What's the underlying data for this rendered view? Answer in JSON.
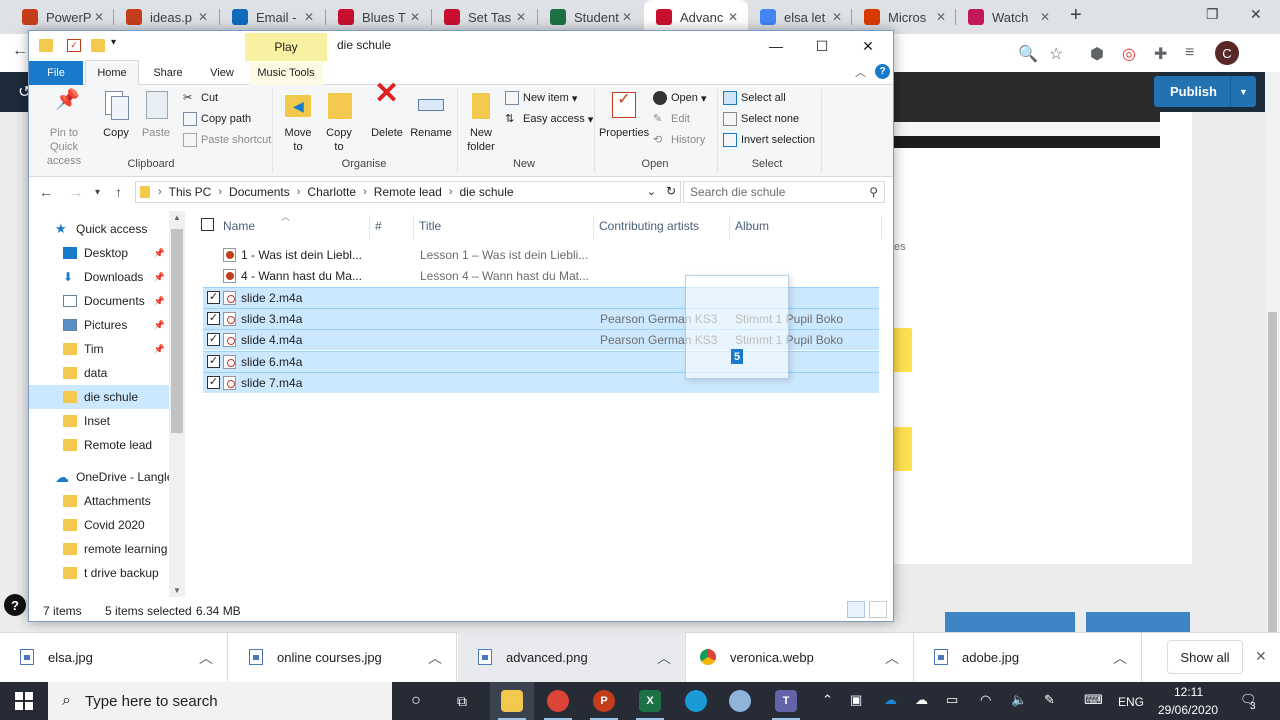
{
  "browser": {
    "tabs": [
      {
        "label": "PowerP",
        "icon": "powerpoint-icon",
        "color": "#c43e1c"
      },
      {
        "label": "ideas.p",
        "icon": "powerpoint-icon",
        "color": "#c43e1c"
      },
      {
        "label": "Email -",
        "icon": "outlook-icon",
        "color": "#0f6cbd"
      },
      {
        "label": "Blues T",
        "icon": "adobe-spark-icon",
        "color": "#c8102e"
      },
      {
        "label": "Set Tas",
        "icon": "adobe-spark-icon",
        "color": "#c8102e"
      },
      {
        "label": "Student",
        "icon": "excel-icon",
        "color": "#1e7145"
      },
      {
        "label": "Advanc",
        "icon": "adobe-spark-icon",
        "color": "#c8102e"
      },
      {
        "label": "elsa let",
        "icon": "google-icon",
        "color": "#4285f4"
      },
      {
        "label": "Micros",
        "icon": "office-icon",
        "color": "#d83b01"
      },
      {
        "label": "Watch",
        "icon": "play-icon",
        "color": "#c2185b"
      }
    ],
    "new_tab": "+",
    "profile_initial": "C",
    "publish_label": "Publish",
    "page_text": "es"
  },
  "explorer": {
    "title": "die schule",
    "context_tab": "Play",
    "ribbon_tabs": [
      "File",
      "Home",
      "Share",
      "View",
      "Music Tools"
    ],
    "clipboard": {
      "pin": "Pin to Quick access",
      "copy": "Copy",
      "paste": "Paste",
      "cut": "Cut",
      "copy_path": "Copy path",
      "paste_shortcut": "Paste shortcut",
      "label": "Clipboard"
    },
    "organise": {
      "move_to": "Move to",
      "copy_to": "Copy to",
      "delete": "Delete",
      "rename": "Rename",
      "label": "Organise"
    },
    "new": {
      "new_folder": "New folder",
      "new_item": "New item",
      "easy_access": "Easy access",
      "label": "New"
    },
    "open": {
      "properties": "Properties",
      "open": "Open",
      "edit": "Edit",
      "history": "History",
      "label": "Open"
    },
    "select": {
      "select_all": "Select all",
      "select_none": "Select none",
      "invert": "Invert selection",
      "label": "Select"
    },
    "breadcrumb": [
      "This PC",
      "Documents",
      "Charlotte",
      "Remote lead",
      "die schule"
    ],
    "search_placeholder": "Search die schule",
    "nav": [
      {
        "label": "Quick access",
        "icon": "star-icon",
        "pinned": false,
        "indent": 0
      },
      {
        "label": "Desktop",
        "icon": "desktop-icon",
        "pinned": true,
        "indent": 1
      },
      {
        "label": "Downloads",
        "icon": "download-icon",
        "pinned": true,
        "indent": 1
      },
      {
        "label": "Documents",
        "icon": "documents-icon",
        "pinned": true,
        "indent": 1
      },
      {
        "label": "Pictures",
        "icon": "pictures-icon",
        "pinned": true,
        "indent": 1
      },
      {
        "label": "Tim",
        "icon": "folder-icon",
        "pinned": true,
        "indent": 1
      },
      {
        "label": "data",
        "icon": "folder-icon",
        "pinned": false,
        "indent": 1
      },
      {
        "label": "die schule",
        "icon": "folder-icon",
        "pinned": false,
        "indent": 1,
        "selected": true
      },
      {
        "label": "Inset",
        "icon": "folder-icon",
        "pinned": false,
        "indent": 1
      },
      {
        "label": "Remote lead",
        "icon": "folder-icon",
        "pinned": false,
        "indent": 1
      },
      {
        "label": "OneDrive - Langle",
        "icon": "onedrive-icon",
        "pinned": false,
        "indent": 0
      },
      {
        "label": "Attachments",
        "icon": "folder-icon",
        "pinned": false,
        "indent": 1
      },
      {
        "label": "Covid 2020",
        "icon": "folder-icon",
        "pinned": false,
        "indent": 1
      },
      {
        "label": "remote learning",
        "icon": "folder-icon",
        "pinned": false,
        "indent": 1
      },
      {
        "label": "t drive backup",
        "icon": "folder-icon",
        "pinned": false,
        "indent": 1
      }
    ],
    "columns": [
      "Name",
      "#",
      "Title",
      "Contributing artists",
      "Album"
    ],
    "files": [
      {
        "name": "1 - Was ist dein Liebl...",
        "title": "Lesson 1 – Was ist dein Liebli...",
        "artist": "",
        "album": "",
        "type": "ppt",
        "selected": false
      },
      {
        "name": "4 - Wann hast du Ma...",
        "title": "Lesson 4 – Wann hast du Mat...",
        "artist": "",
        "album": "",
        "type": "ppt",
        "selected": false
      },
      {
        "name": "slide 2.m4a",
        "title": "",
        "artist": "",
        "album": "",
        "type": "audio",
        "selected": true
      },
      {
        "name": "slide 3.m4a",
        "title": "",
        "artist": "Pearson German KS3",
        "album": "Stimmt 1 Pupil Boko",
        "type": "audio",
        "selected": true
      },
      {
        "name": "slide 4.m4a",
        "title": "",
        "artist": "Pearson German KS3",
        "album": "Stimmt 1 Pupil Boko",
        "type": "audio",
        "selected": true
      },
      {
        "name": "slide 6.m4a",
        "title": "",
        "artist": "",
        "album": "",
        "type": "audio",
        "selected": true
      },
      {
        "name": "slide 7.m4a",
        "title": "",
        "artist": "",
        "album": "",
        "type": "audio",
        "selected": true
      }
    ],
    "drag_count": "5",
    "status": {
      "items": "7 items",
      "selected": "5 items selected",
      "size": "6.34 MB"
    }
  },
  "downloads": {
    "items": [
      "elsa.jpg",
      "online courses.jpg",
      "advanced.png",
      "veronica.webp",
      "adobe.jpg"
    ],
    "show_all": "Show all"
  },
  "taskbar": {
    "search_placeholder": "Type here to search",
    "language": "ENG",
    "time": "12:11",
    "date": "29/06/2020",
    "notifications": "3"
  }
}
